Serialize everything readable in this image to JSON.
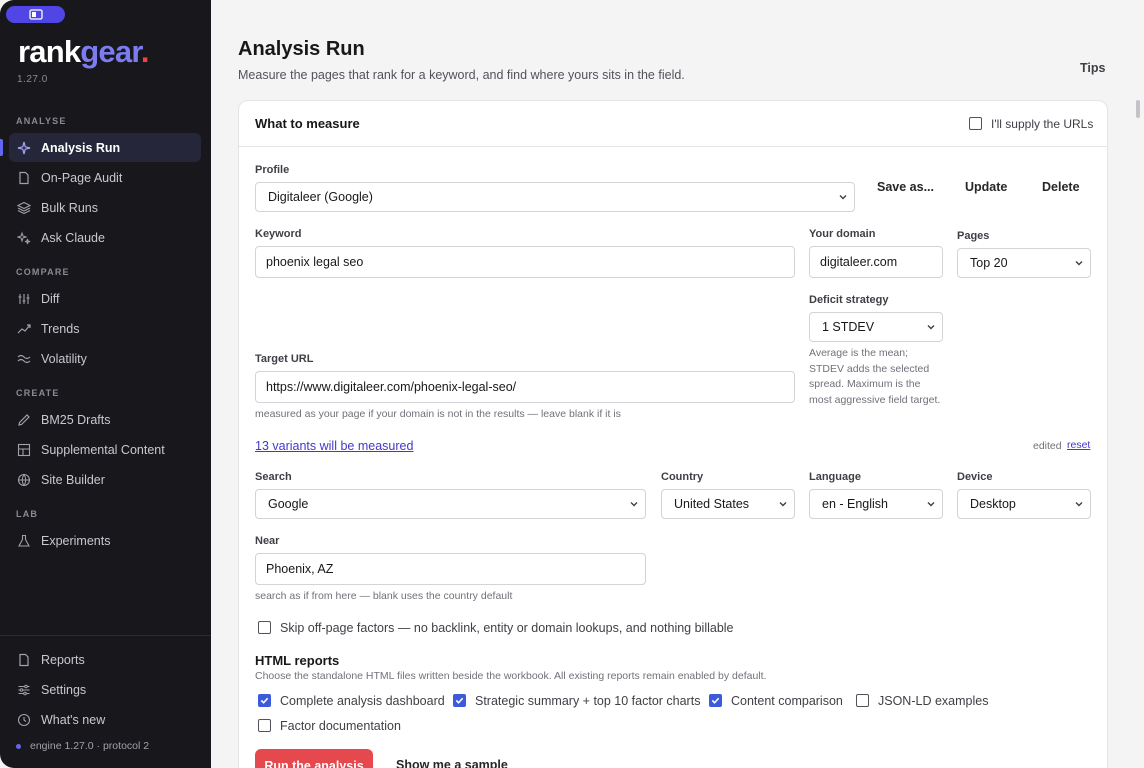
{
  "app": {
    "logo_a": "rank",
    "logo_b": "gear",
    "logo_dot": ".",
    "version": "1.27.0",
    "engine_status": "engine 1.27.0 · protocol 2"
  },
  "sidebar": {
    "sections": {
      "analyse": "ANALYSE",
      "compare": "COMPARE",
      "create": "CREATE",
      "lab": "LAB"
    },
    "items": {
      "analysis_run": "Analysis Run",
      "on_page_audit": "On-Page Audit",
      "bulk_runs": "Bulk Runs",
      "ask_claude": "Ask Claude",
      "diff": "Diff",
      "trends": "Trends",
      "volatility": "Volatility",
      "bm25_drafts": "BM25 Drafts",
      "supplemental_content": "Supplemental Content",
      "site_builder": "Site Builder",
      "experiments": "Experiments",
      "reports": "Reports",
      "settings": "Settings",
      "whats_new": "What's new"
    }
  },
  "header": {
    "title": "Analysis Run",
    "subtitle": "Measure the pages that rank for a keyword, and find where yours sits in the field.",
    "tips": "Tips"
  },
  "form": {
    "card_title": "What to measure",
    "supply_urls_label": "I'll supply the URLs",
    "supply_urls_checked": false,
    "profile_label": "Profile",
    "profile_value": "Digitaleer (Google)",
    "save_as": "Save as...",
    "update": "Update",
    "delete": "Delete",
    "keyword_label": "Keyword",
    "keyword_value": "phoenix legal seo",
    "domain_label": "Your domain",
    "domain_value": "digitaleer.com",
    "pages_label": "Pages",
    "pages_value": "Top 20",
    "deficit_label": "Deficit strategy",
    "deficit_value": "1 STDEV",
    "deficit_help": "Average is the mean; STDEV adds the selected spread. Maximum is the most aggressive field target.",
    "target_url_label": "Target URL",
    "target_url_value": "https://www.digitaleer.com/phoenix-legal-seo/",
    "target_url_help": "measured as your page if your domain is not in the results — leave blank if it is",
    "variants_link": "13 variants will be measured",
    "edited_text": "edited",
    "reset_link": "reset",
    "search_label": "Search",
    "search_value": "Google",
    "country_label": "Country",
    "country_value": "United States",
    "language_label": "Language",
    "language_value": "en - English",
    "device_label": "Device",
    "device_value": "Desktop",
    "near_label": "Near",
    "near_value": "Phoenix, AZ",
    "near_help": "search as if from here — blank uses the country default",
    "skip_offpage_label": "Skip off-page factors — no backlink, entity or domain lookups, and nothing billable",
    "skip_offpage_checked": false,
    "reports_title": "HTML reports",
    "reports_sub": "Choose the standalone HTML files written beside the workbook. All existing reports remain enabled by default.",
    "report_options": {
      "dashboard": "Complete analysis dashboard",
      "strategic": "Strategic summary + top 10 factor charts",
      "content": "Content comparison",
      "jsonld": "JSON-LD examples",
      "factor_docs": "Factor documentation"
    },
    "report_checked": {
      "dashboard": true,
      "strategic": true,
      "content": true,
      "jsonld": false,
      "factor_docs": false
    },
    "run_button": "Run the analysis",
    "sample_button": "Show me a sample"
  },
  "colors": {
    "sidebar_bg": "#17171c",
    "accent": "#6366f1",
    "run_button": "#e5484d",
    "checkbox_on": "#3b5bdb"
  }
}
